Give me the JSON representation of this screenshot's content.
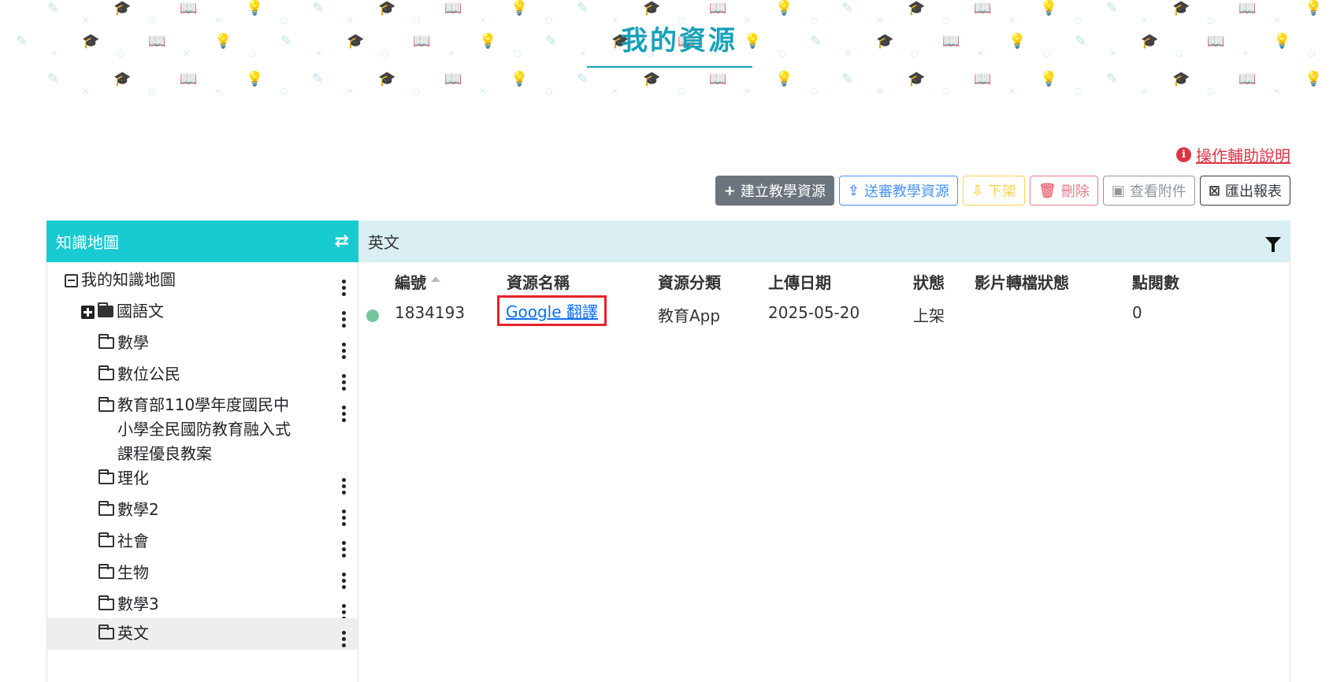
{
  "page": {
    "title": "我的資源"
  },
  "help": {
    "icon": "info-circle-icon",
    "label": "操作輔助說明"
  },
  "toolbar": {
    "create": {
      "label": "建立教學資源",
      "icon": "plus-icon"
    },
    "submit": {
      "label": "送審教學資源",
      "icon": "file-upload-icon"
    },
    "unpublish": {
      "label": "下架",
      "icon": "file-download-icon"
    },
    "delete": {
      "label": "刪除",
      "icon": "trash-icon"
    },
    "attachments": {
      "label": "查看附件",
      "icon": "images-icon"
    },
    "export": {
      "label": "匯出報表",
      "icon": "excel-file-icon"
    }
  },
  "sidebar": {
    "title": "知識地圖",
    "swap_icon": "swap-arrows-icon",
    "root": "我的知識地圖",
    "items": [
      {
        "label": "國語文"
      },
      {
        "label": "數學"
      },
      {
        "label": "數位公民"
      },
      {
        "label_lines": [
          "教育部110學年度國民中",
          "小學全民國防教育融入式",
          "課程優良教案"
        ]
      },
      {
        "label": "理化"
      },
      {
        "label": "數學2"
      },
      {
        "label": "社會"
      },
      {
        "label": "生物"
      },
      {
        "label": "數學3"
      },
      {
        "label": "英文"
      }
    ],
    "selected": "英文"
  },
  "main": {
    "header": "英文",
    "filter_icon": "filter-icon",
    "columns": [
      "編號",
      "資源名稱",
      "資源分類",
      "上傳日期",
      "狀態",
      "影片轉檔狀態",
      "點閱數"
    ],
    "rows": [
      {
        "status_color": "#74c69d",
        "id": "1834193",
        "name": "Google 翻譯",
        "category": "教育App",
        "date": "2025-05-20",
        "status": "上架",
        "video_status": "",
        "views": "0"
      }
    ]
  }
}
